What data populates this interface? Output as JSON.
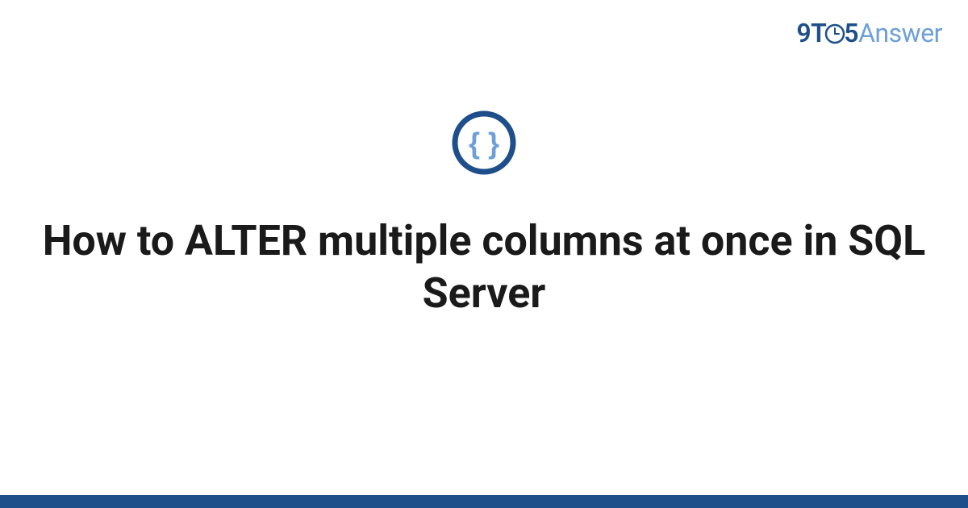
{
  "logo": {
    "part1": "9T",
    "part2": "5",
    "part3": "Answer"
  },
  "icon": {
    "name": "code-braces-icon"
  },
  "title": "How to ALTER multiple columns at once in SQL Server",
  "colors": {
    "primary": "#1e4f8a",
    "accent": "#6ca0d6"
  }
}
